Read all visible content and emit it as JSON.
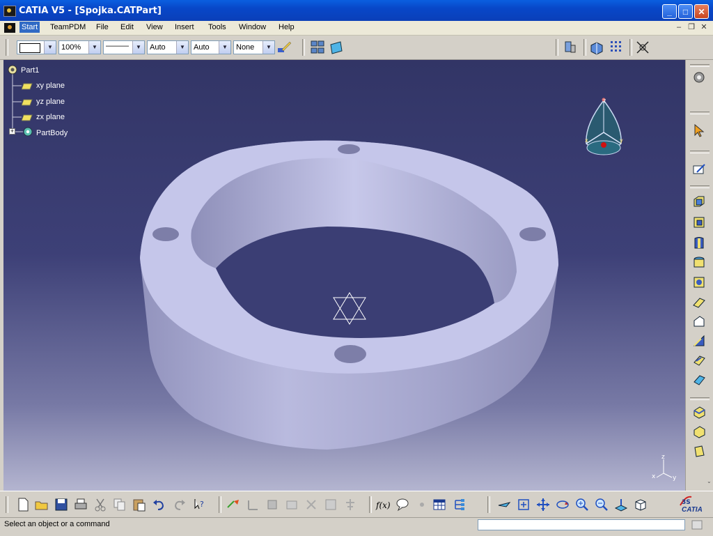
{
  "window": {
    "title": "CATIA V5 - [Spojka.CATPart]",
    "controls": {
      "minimize": "_",
      "maximize": "□",
      "close": "✕"
    }
  },
  "menubar": {
    "items": [
      "Start",
      "TeamPDM",
      "File",
      "Edit",
      "View",
      "Insert",
      "Tools",
      "Window",
      "Help"
    ]
  },
  "toolbar": {
    "color_combo": "",
    "transparency_combo": "100%",
    "linetype_combo": "———",
    "thickness_combo": "Auto",
    "point_combo": "Auto",
    "layer_combo": "None"
  },
  "tree": {
    "root": "Part1",
    "children": [
      "xy plane",
      "yz plane",
      "zx plane",
      "PartBody"
    ]
  },
  "compass_axes": {
    "z": "z",
    "x": "x",
    "y": "y"
  },
  "axis_triad": {
    "z": "z",
    "x": "x",
    "y": "y"
  },
  "status": {
    "message": "Select an object or a command",
    "command_input": ""
  },
  "brand": {
    "logo_text": "CATIA"
  },
  "colors": {
    "viewport_top": "#323566",
    "viewport_bottom": "#b4b5d0",
    "part_light": "#c4c5e8",
    "part_dark": "#8788b0",
    "selected_menu": "#316ac5"
  }
}
